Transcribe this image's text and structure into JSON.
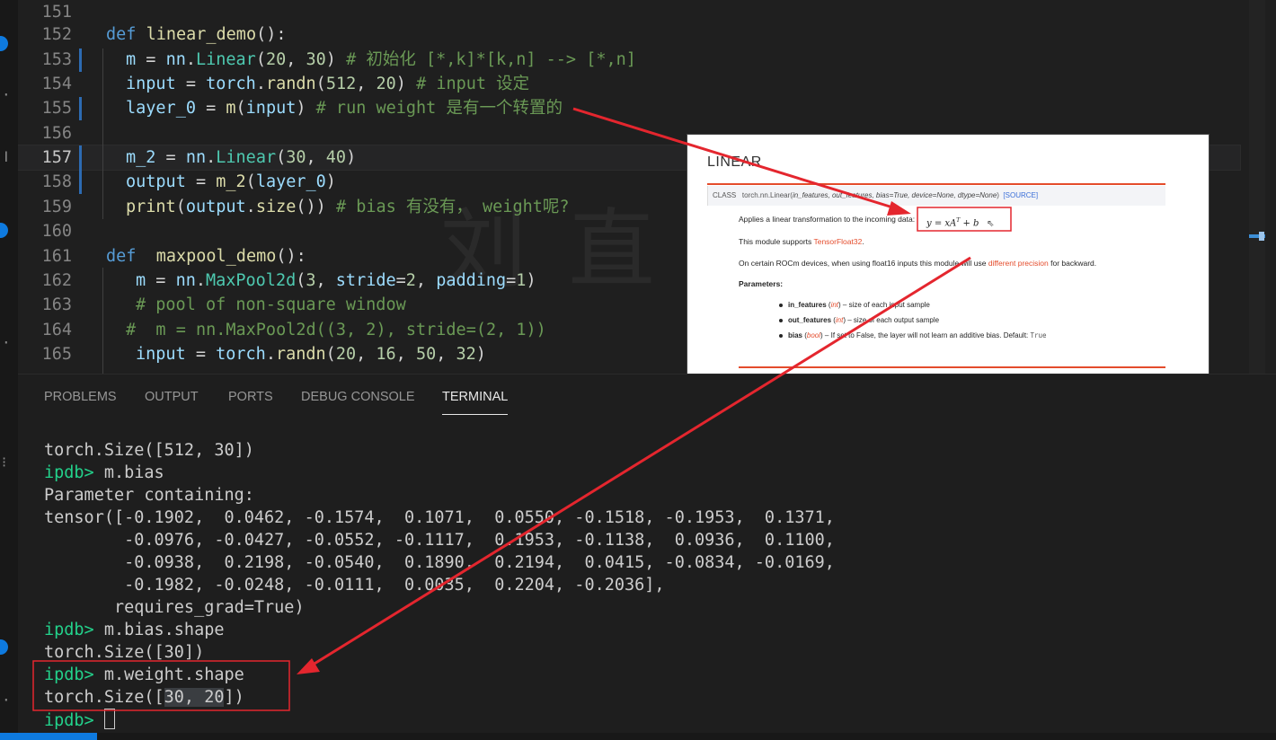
{
  "editor": {
    "lines": [
      {
        "num": "151",
        "tokens": []
      },
      {
        "num": "152",
        "tokens": [
          [
            "kw",
            "def "
          ],
          [
            "fn",
            "linear_demo"
          ],
          [
            "p",
            "():"
          ]
        ]
      },
      {
        "num": "153",
        "tokens": [
          [
            "var",
            "m"
          ],
          [
            "p",
            " = "
          ],
          [
            "var",
            "nn"
          ],
          [
            "p",
            "."
          ],
          [
            "cls",
            "Linear"
          ],
          [
            "p",
            "("
          ],
          [
            "num",
            "20"
          ],
          [
            "p",
            ", "
          ],
          [
            "num",
            "30"
          ],
          [
            "p",
            ") "
          ],
          [
            "cm",
            "# 初始化 [*,k]*[k,n] --> [*,n]"
          ]
        ]
      },
      {
        "num": "154",
        "tokens": [
          [
            "var",
            "input"
          ],
          [
            "p",
            " = "
          ],
          [
            "var",
            "torch"
          ],
          [
            "p",
            "."
          ],
          [
            "fn",
            "randn"
          ],
          [
            "p",
            "("
          ],
          [
            "num",
            "512"
          ],
          [
            "p",
            ", "
          ],
          [
            "num",
            "20"
          ],
          [
            "p",
            ") "
          ],
          [
            "cm",
            "# input 设定"
          ]
        ]
      },
      {
        "num": "155",
        "tokens": [
          [
            "var",
            "layer_0"
          ],
          [
            "p",
            " = "
          ],
          [
            "fn",
            "m"
          ],
          [
            "p",
            "("
          ],
          [
            "var",
            "input"
          ],
          [
            "p",
            ") "
          ],
          [
            "cm",
            "# run weight 是有一个转置的"
          ]
        ]
      },
      {
        "num": "156",
        "tokens": []
      },
      {
        "num": "157",
        "tokens": [
          [
            "var",
            "m_2"
          ],
          [
            "p",
            " = "
          ],
          [
            "var",
            "nn"
          ],
          [
            "p",
            "."
          ],
          [
            "cls",
            "Linear"
          ],
          [
            "p",
            "("
          ],
          [
            "num",
            "30"
          ],
          [
            "p",
            ", "
          ],
          [
            "num",
            "40"
          ],
          [
            "p",
            ")"
          ]
        ]
      },
      {
        "num": "158",
        "tokens": [
          [
            "var",
            "output"
          ],
          [
            "p",
            " = "
          ],
          [
            "fn",
            "m_2"
          ],
          [
            "p",
            "("
          ],
          [
            "var",
            "layer_0"
          ],
          [
            "p",
            ")"
          ]
        ]
      },
      {
        "num": "159",
        "tokens": [
          [
            "fn",
            "print"
          ],
          [
            "p",
            "("
          ],
          [
            "var",
            "output"
          ],
          [
            "p",
            "."
          ],
          [
            "fn",
            "size"
          ],
          [
            "p",
            "()) "
          ],
          [
            "cm",
            "# bias 有没有， weight呢?"
          ]
        ]
      },
      {
        "num": "160",
        "tokens": []
      },
      {
        "num": "161",
        "tokens": [
          [
            "kw",
            "def  "
          ],
          [
            "fn",
            "maxpool_demo"
          ],
          [
            "p",
            "():"
          ]
        ]
      },
      {
        "num": "162",
        "tokens": [
          [
            "var",
            "m"
          ],
          [
            "p",
            " = "
          ],
          [
            "var",
            "nn"
          ],
          [
            "p",
            "."
          ],
          [
            "cls",
            "MaxPool2d"
          ],
          [
            "p",
            "("
          ],
          [
            "num",
            "3"
          ],
          [
            "p",
            ", "
          ],
          [
            "var",
            "stride"
          ],
          [
            "p",
            "="
          ],
          [
            "num",
            "2"
          ],
          [
            "p",
            ", "
          ],
          [
            "var",
            "padding"
          ],
          [
            "p",
            "="
          ],
          [
            "num",
            "1"
          ],
          [
            "p",
            ")"
          ]
        ]
      },
      {
        "num": "163",
        "tokens": [
          [
            "cm",
            "# pool of non-square window"
          ]
        ]
      },
      {
        "num": "164",
        "tokens": [
          [
            "cm",
            "#  m = nn.MaxPool2d((3, 2), stride=(2, 1))"
          ]
        ]
      },
      {
        "num": "165",
        "tokens": [
          [
            "var",
            "input"
          ],
          [
            "p",
            " = "
          ],
          [
            "var",
            "torch"
          ],
          [
            "p",
            "."
          ],
          [
            "fn",
            "randn"
          ],
          [
            "p",
            "("
          ],
          [
            "num",
            "20"
          ],
          [
            "p",
            ", "
          ],
          [
            "num",
            "16"
          ],
          [
            "p",
            ", "
          ],
          [
            "num",
            "50"
          ],
          [
            "p",
            ", "
          ],
          [
            "num",
            "32"
          ],
          [
            "p",
            ")"
          ]
        ]
      }
    ],
    "current_line": "157"
  },
  "doc": {
    "title": "LINEAR",
    "class_label": "CLASS",
    "signature_name": "torch.nn.Linear(",
    "signature_params": "in_features, out_features, bias=True, device=None, dtype=None",
    "signature_close": ")",
    "source_link": "[SOURCE]",
    "intro": "Applies a linear transformation to the incoming data: ",
    "formula_main": "y = xA",
    "formula_sup": "T",
    "formula_tail": " + b",
    "supports_prefix": "This module supports ",
    "supports_link": "TensorFloat32",
    "supports_suffix": ".",
    "rocm_prefix": "On certain ROCm devices, when using float16 inputs this module will use ",
    "rocm_link": "different precision",
    "rocm_suffix": " for backward.",
    "params_heading": "Parameters:",
    "params": [
      {
        "name": "in_features",
        "type": "int",
        "desc": " – size of each input sample",
        "code": ""
      },
      {
        "name": "out_features",
        "type": "int",
        "desc": " – size of each output sample",
        "code": ""
      },
      {
        "name": "bias",
        "type": "bool",
        "desc": " – If set to False, the layer will not learn an additive bias. Default: ",
        "code": "True"
      }
    ]
  },
  "panel": {
    "tabs": [
      {
        "label": "PROBLEMS",
        "active": false
      },
      {
        "label": "OUTPUT",
        "active": false
      },
      {
        "label": "PORTS",
        "active": false
      },
      {
        "label": "DEBUG CONSOLE",
        "active": false
      },
      {
        "label": "TERMINAL",
        "active": true
      }
    ]
  },
  "terminal": {
    "lines": [
      {
        "prompt": "",
        "text": "torch.Size([512, 30])"
      },
      {
        "prompt": "ipdb> ",
        "text": "m.bias"
      },
      {
        "prompt": "",
        "text": "Parameter containing:"
      },
      {
        "prompt": "",
        "text": "tensor([-0.1902,  0.0462, -0.1574,  0.1071,  0.0550, -0.1518, -0.1953,  0.1371,"
      },
      {
        "prompt": "",
        "text": "        -0.0976, -0.0427, -0.0552, -0.1117,  0.1953, -0.1138,  0.0936,  0.1100,"
      },
      {
        "prompt": "",
        "text": "        -0.0938,  0.2198, -0.0540,  0.1890,  0.2194,  0.0415, -0.0834, -0.0169,"
      },
      {
        "prompt": "",
        "text": "        -0.1982, -0.0248, -0.0111,  0.0035,  0.2204, -0.2036],"
      },
      {
        "prompt": "",
        "text": "       requires_grad=True)"
      },
      {
        "prompt": "ipdb> ",
        "text": "m.bias.shape"
      },
      {
        "prompt": "",
        "text": "torch.Size([30])"
      },
      {
        "prompt": "ipdb> ",
        "text": "m.weight.shape"
      },
      {
        "prompt": "",
        "text": "torch.Size([30, 20])",
        "selected": "30, 20"
      },
      {
        "prompt": "ipdb> ",
        "text": "",
        "cursor": true
      }
    ]
  },
  "annotations": {
    "color": "#e4262e"
  },
  "colors": {
    "editor_bg": "#1f1f1f",
    "accent": "#0e7adf",
    "prompt": "#23d18b"
  }
}
